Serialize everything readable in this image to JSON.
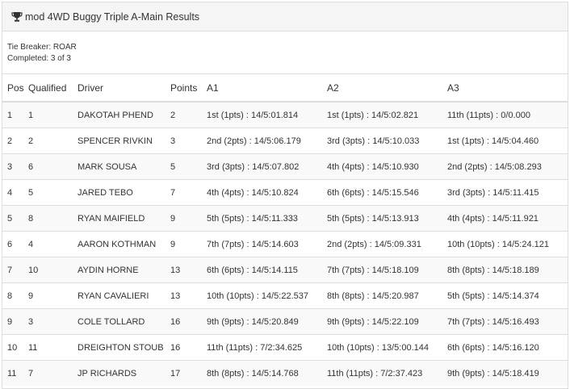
{
  "heading": {
    "icon": "trophy-icon",
    "title": "mod 4WD Buggy Triple A-Main Results"
  },
  "info": {
    "tie_breaker": "Tie Breaker: ROAR",
    "completed": "Completed: 3 of 3"
  },
  "columns": [
    "Pos",
    "Qualified",
    "Driver",
    "Points",
    "A1",
    "A2",
    "A3"
  ],
  "rows": [
    [
      "1",
      "1",
      "DAKOTAH PHEND",
      "2",
      "1st (1pts) : 14/5:01.814",
      "1st (1pts) : 14/5:02.821",
      "11th (11pts) : 0/0.000"
    ],
    [
      "2",
      "2",
      "SPENCER RIVKIN",
      "3",
      "2nd (2pts) : 14/5:06.179",
      "3rd (3pts) : 14/5:10.033",
      "1st (1pts) : 14/5:04.460"
    ],
    [
      "3",
      "6",
      "MARK SOUSA",
      "5",
      "3rd (3pts) : 14/5:07.802",
      "4th (4pts) : 14/5:10.930",
      "2nd (2pts) : 14/5:08.293"
    ],
    [
      "4",
      "5",
      "JARED TEBO",
      "7",
      "4th (4pts) : 14/5:10.824",
      "6th (6pts) : 14/5:15.546",
      "3rd (3pts) : 14/5:11.415"
    ],
    [
      "5",
      "8",
      "RYAN MAIFIELD",
      "9",
      "5th (5pts) : 14/5:11.333",
      "5th (5pts) : 14/5:13.913",
      "4th (4pts) : 14/5:11.921"
    ],
    [
      "6",
      "4",
      "AARON KOTHMAN",
      "9",
      "7th (7pts) : 14/5:14.603",
      "2nd (2pts) : 14/5:09.331",
      "10th (10pts) : 14/5:24.121"
    ],
    [
      "7",
      "10",
      "AYDIN HORNE",
      "13",
      "6th (6pts) : 14/5:14.115",
      "7th (7pts) : 14/5:18.109",
      "8th (8pts) : 14/5:18.189"
    ],
    [
      "8",
      "9",
      "RYAN CAVALIERI",
      "13",
      "10th (10pts) : 14/5:22.537",
      "8th (8pts) : 14/5:20.987",
      "5th (5pts) : 14/5:14.374"
    ],
    [
      "9",
      "3",
      "COLE TOLLARD",
      "16",
      "9th (9pts) : 14/5:20.849",
      "9th (9pts) : 14/5:22.109",
      "7th (7pts) : 14/5:16.493"
    ],
    [
      "10",
      "11",
      "DREIGHTON STOUB",
      "16",
      "11th (11pts) : 7/2:34.625",
      "10th (10pts) : 13/5:00.144",
      "6th (6pts) : 14/5:16.120"
    ],
    [
      "11",
      "7",
      "JP RICHARDS",
      "17",
      "8th (8pts) : 14/5:14.768",
      "11th (11pts) : 7/2:37.423",
      "9th (9pts) : 14/5:18.419"
    ]
  ]
}
